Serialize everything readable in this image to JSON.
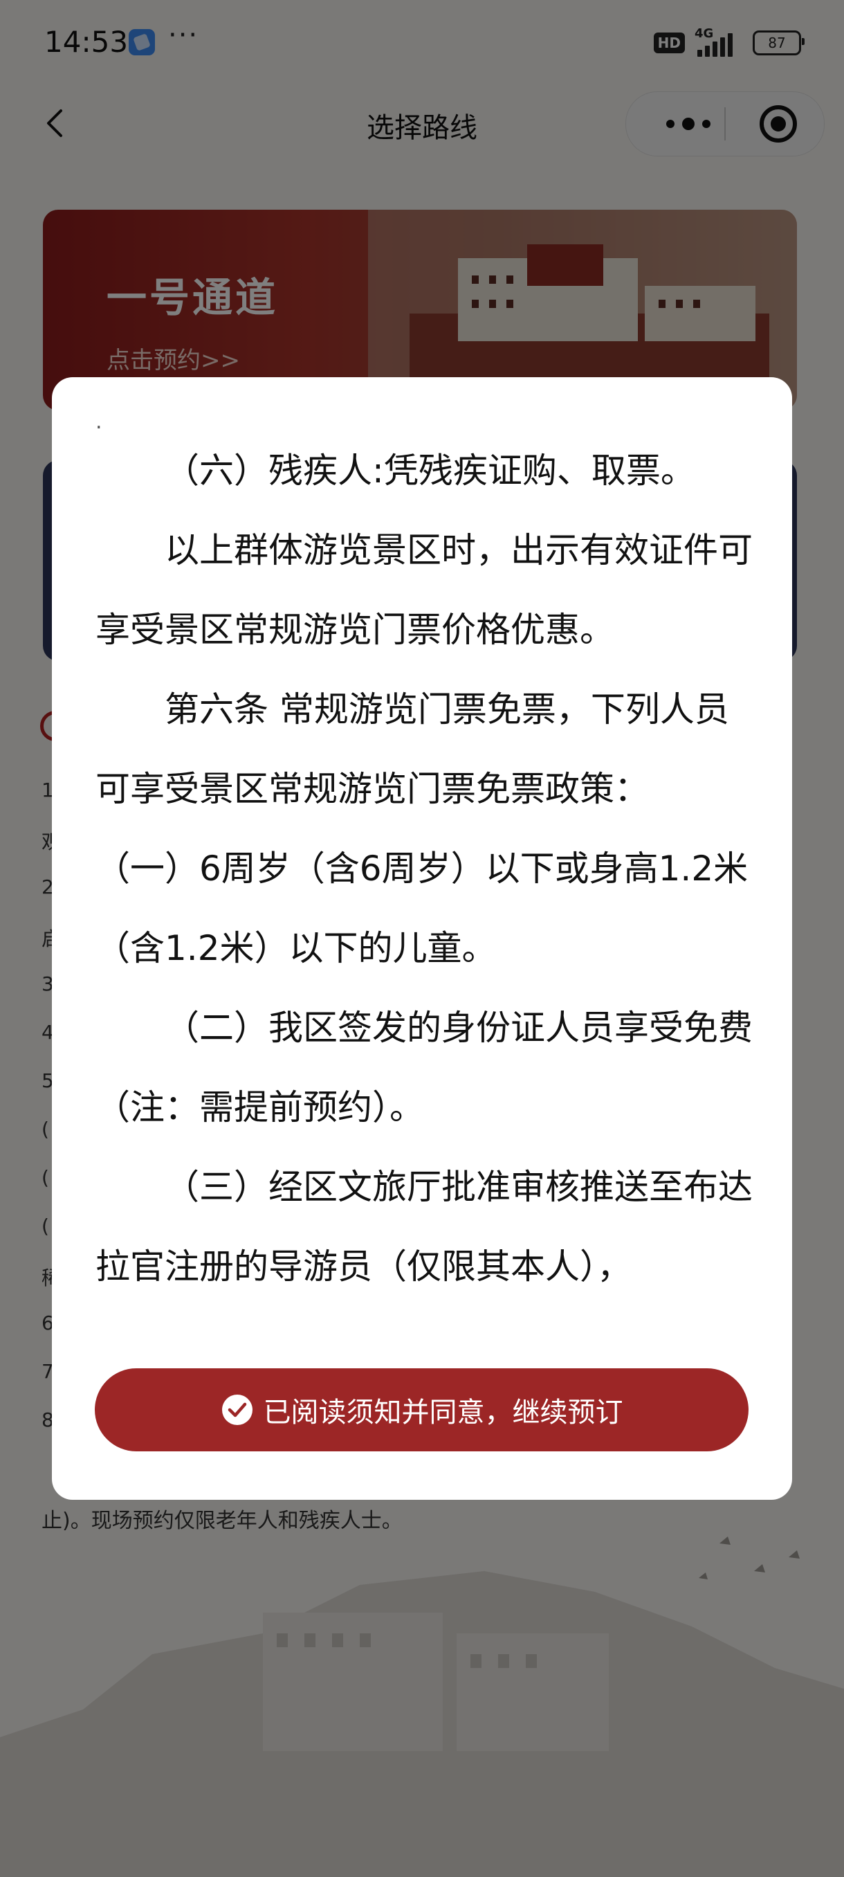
{
  "status_bar": {
    "time": "14:53",
    "more": "···",
    "hd": "HD",
    "network": "4G",
    "battery": "87"
  },
  "nav": {
    "title": "选择路线"
  },
  "banner": {
    "title": "一号通道",
    "link": "点击预约>>"
  },
  "background": {
    "line_prefixes": [
      "1",
      "观",
      "2",
      "启",
      "3",
      "4",
      "5",
      "(",
      "(",
      "(",
      "稀",
      "6",
      "7",
      "8"
    ],
    "footer": "止)。现场预约仅限老年人和残疾人士。"
  },
  "modal": {
    "paragraphs": [
      "（六）残疾人:凭残疾证购、取票。",
      "以上群体游览景区时，出示有效证件可享受景区常规游览门票价格优惠。",
      "第六条 常规游览门票免票，下列人员可享受景区常规游览门票免票政策：",
      "（一）6周岁（含6周岁）以下或身高1.2米（含1.2米）以下的儿童。",
      "（二）我区签发的身份证人员享受免费（注：需提前预约）。",
      "（三）经区文旅厅批准审核推送至布达拉官注册的导游员（仅限其本人），"
    ],
    "agree_label": "已阅读须知并同意，继续预订"
  },
  "colors": {
    "accent": "#9c2626",
    "overlay": "rgba(0,0,0,0.5)"
  }
}
